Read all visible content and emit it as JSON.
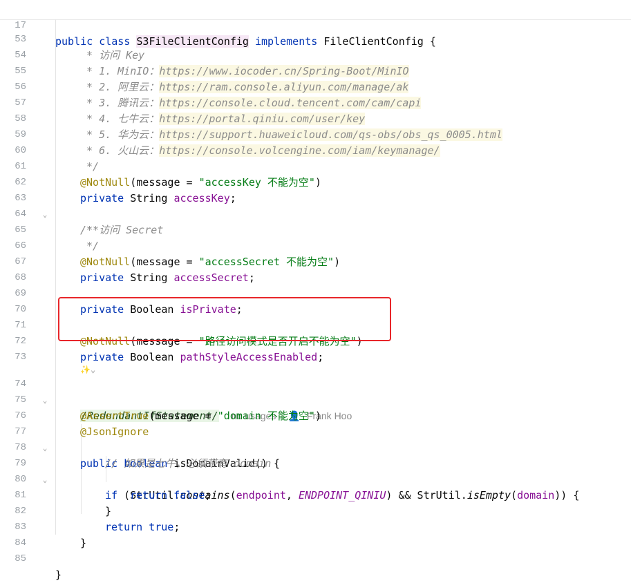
{
  "editor": {
    "sticky": {
      "line_no": "17",
      "parts": [
        "public",
        "class",
        "S3FileClientConfig",
        "implements",
        "FileClientConfig",
        "{"
      ]
    },
    "lines": [
      {
        "no": "53",
        "text": " * 访问 Key"
      },
      {
        "no": "54",
        "prefix": " * 1. MinIO：",
        "url": "https://www.iocoder.cn/Spring-Boot/MinIO"
      },
      {
        "no": "55",
        "prefix": " * 2. 阿里云：",
        "url": "https://ram.console.aliyun.com/manage/ak"
      },
      {
        "no": "56",
        "prefix": " * 3. 腾讯云：",
        "url": "https://console.cloud.tencent.com/cam/capi"
      },
      {
        "no": "57",
        "prefix": " * 4. 七牛云：",
        "url": "https://portal.qiniu.com/user/key"
      },
      {
        "no": "58",
        "prefix": " * 5. 华为云：",
        "url": "https://support.huaweicloud.com/qs-obs/obs_qs_0005.html"
      },
      {
        "no": "59",
        "prefix": " * 6. 火山云：",
        "url": "https://console.volcengine.com/iam/keymanage/"
      },
      {
        "no": "60",
        "text": " */"
      },
      {
        "no": "61",
        "ann": "@NotNull",
        "mid": "(message = ",
        "str": "\"accessKey 不能为空\"",
        "end": ")"
      },
      {
        "no": "62",
        "kw": "private",
        "ty": " String ",
        "fld": "accessKey",
        "end": ";"
      },
      {
        "no": "63",
        "text": "/**"
      },
      {
        "no": "64",
        "text": " * 访问 Secret"
      },
      {
        "no": "65",
        "text": " */"
      },
      {
        "no": "66",
        "ann": "@NotNull",
        "mid": "(message = ",
        "str": "\"accessSecret 不能为空\"",
        "end": ")"
      },
      {
        "no": "67",
        "kw": "private",
        "ty": " String ",
        "fld": "accessSecret",
        "end": ";"
      },
      {
        "no": "68"
      },
      {
        "no": "69",
        "kw": "private",
        "ty": " Boolean ",
        "fld": "isPrivate",
        "end": ";"
      },
      {
        "no": "70"
      },
      {
        "no": "71",
        "ann": "@NotNull",
        "mid": "(message = ",
        "str": "\"路径访问模式是否开启不能为空\"",
        "end": ")"
      },
      {
        "no": "72",
        "kw": "private",
        "ty": " Boolean ",
        "fld": "pathStyleAccessEnabled",
        "end": ";"
      },
      {
        "no": "73"
      },
      {
        "no": "74",
        "suppress": "/RedundantIfStatement/",
        "usages": "no usages",
        "author": "Frank Hoo"
      },
      {
        "no": "75",
        "ann": "@AssertTrue",
        "mid": "(message = ",
        "str": "\"domain 不能为空\"",
        "end": ")"
      },
      {
        "no": "76",
        "ann": "@JsonIgnore"
      },
      {
        "no": "77",
        "kw1": "public",
        "kw2": "boolean",
        "rest": " isDomainValid() {"
      },
      {
        "no": "78",
        "text": "// 如果是七牛，必须带有 domain"
      },
      {
        "no": "79",
        "kw": "if",
        "a": " (StrUtil.",
        "m1": "contains",
        "b": "(",
        "p1": "endpoint",
        "c": ", ",
        "st": "ENDPOINT_QINIU",
        "d": ") && StrUtil.",
        "m2": "isEmpty",
        "e": "(",
        "p2": "domain",
        "f": ")) {"
      },
      {
        "no": "80",
        "kw": "return",
        "lit": "false",
        "end": ";"
      },
      {
        "no": "81",
        "text": "}"
      },
      {
        "no": "82",
        "kw": "return",
        "lit": "true",
        "end": ";"
      },
      {
        "no": "83",
        "text": "}"
      },
      {
        "no": "84"
      },
      {
        "no": "85",
        "text": "}"
      }
    ]
  }
}
